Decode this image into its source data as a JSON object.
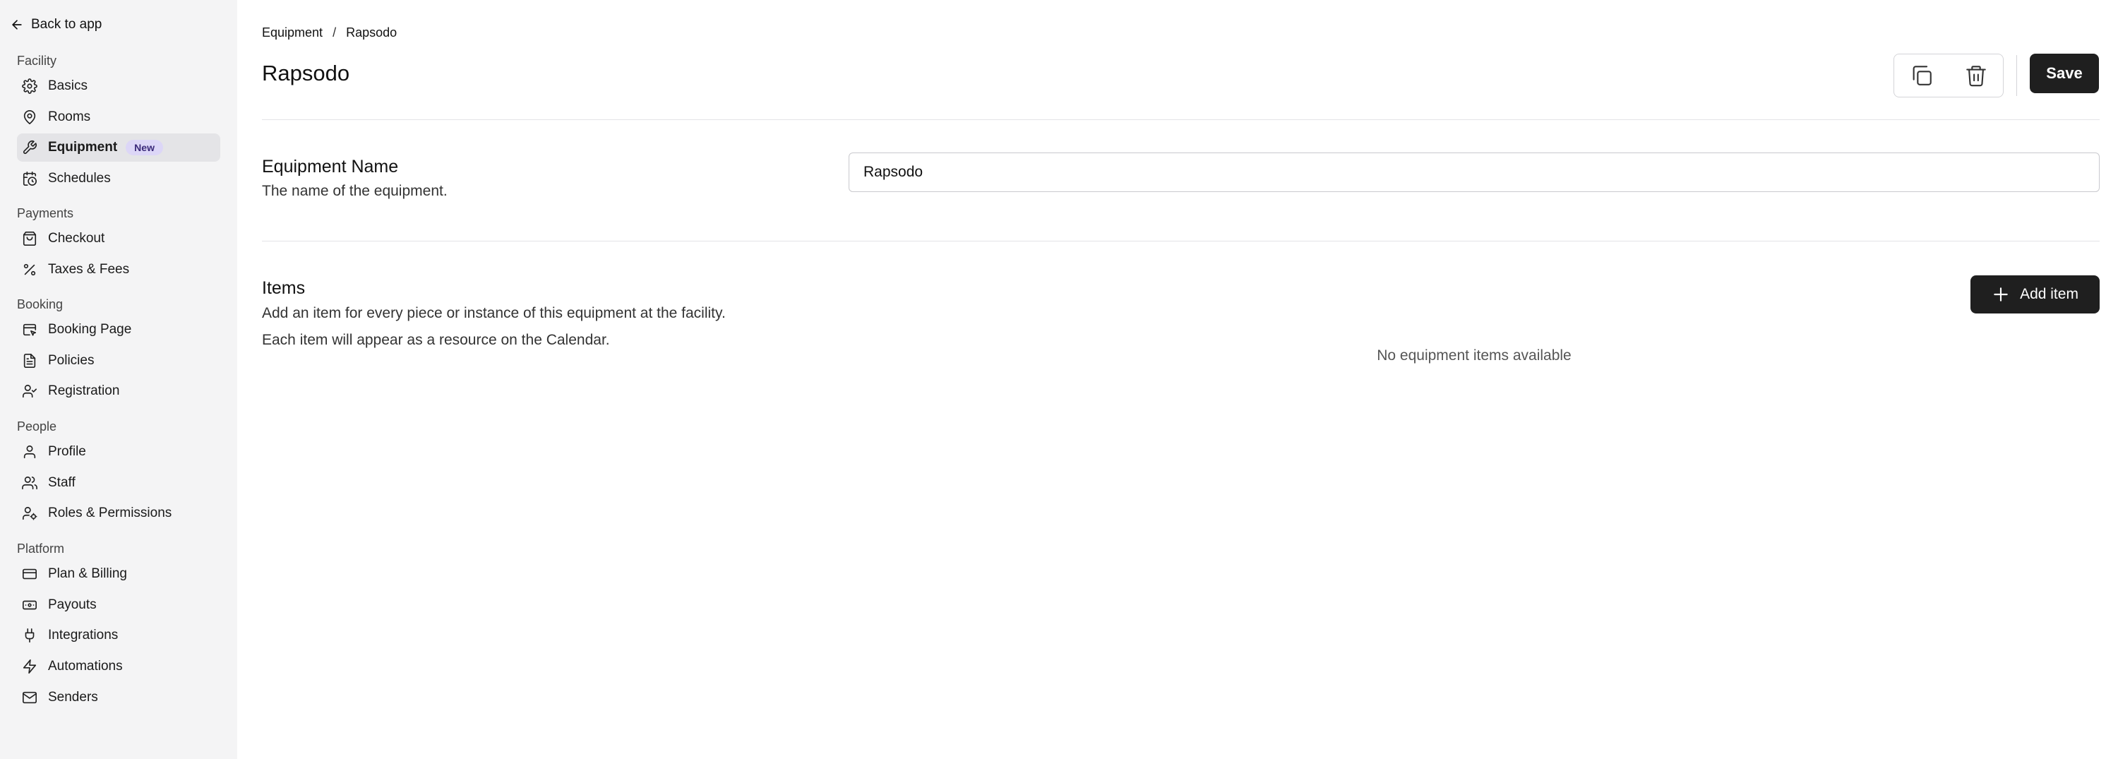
{
  "sidebar": {
    "back_label": "Back to app",
    "sections": [
      {
        "label": "Facility",
        "items": [
          {
            "label": "Basics",
            "icon": "gear-icon"
          },
          {
            "label": "Rooms",
            "icon": "map-pin-icon"
          },
          {
            "label": "Equipment",
            "icon": "wrench-icon",
            "badge": "New",
            "active": true
          },
          {
            "label": "Schedules",
            "icon": "calendar-clock-icon"
          }
        ]
      },
      {
        "label": "Payments",
        "items": [
          {
            "label": "Checkout",
            "icon": "shopping-bag-icon"
          },
          {
            "label": "Taxes & Fees",
            "icon": "percent-icon"
          }
        ]
      },
      {
        "label": "Booking",
        "items": [
          {
            "label": "Booking Page",
            "icon": "browser-pointer-icon"
          },
          {
            "label": "Policies",
            "icon": "document-icon"
          },
          {
            "label": "Registration",
            "icon": "user-check-icon"
          }
        ]
      },
      {
        "label": "People",
        "items": [
          {
            "label": "Profile",
            "icon": "user-icon"
          },
          {
            "label": "Staff",
            "icon": "users-icon"
          },
          {
            "label": "Roles & Permissions",
            "icon": "user-cog-icon"
          }
        ]
      },
      {
        "label": "Platform",
        "items": [
          {
            "label": "Plan & Billing",
            "icon": "credit-card-icon"
          },
          {
            "label": "Payouts",
            "icon": "banknote-icon"
          },
          {
            "label": "Integrations",
            "icon": "plug-icon"
          },
          {
            "label": "Automations",
            "icon": "zap-icon"
          },
          {
            "label": "Senders",
            "icon": "mail-icon"
          }
        ]
      }
    ]
  },
  "breadcrumb": {
    "parent": "Equipment",
    "separator": "/",
    "current": "Rapsodo"
  },
  "page": {
    "title": "Rapsodo"
  },
  "toolbar": {
    "duplicate_icon": "copy-icon",
    "delete_icon": "trash-icon",
    "save_label": "Save"
  },
  "name_field": {
    "title": "Equipment Name",
    "description": "The name of the equipment.",
    "value": "Rapsodo"
  },
  "items_section": {
    "title": "Items",
    "description": "Add an item for every piece or instance of this equipment at the facility. Each item will appear as a resource on the Calendar.",
    "add_label": "Add item",
    "empty_text": "No equipment items available"
  },
  "colors": {
    "button_dark": "#1f1f1f",
    "sidebar_bg": "#f4f4f5",
    "active_bg": "#e4e4e7",
    "badge_bg": "#dcd6f7"
  }
}
